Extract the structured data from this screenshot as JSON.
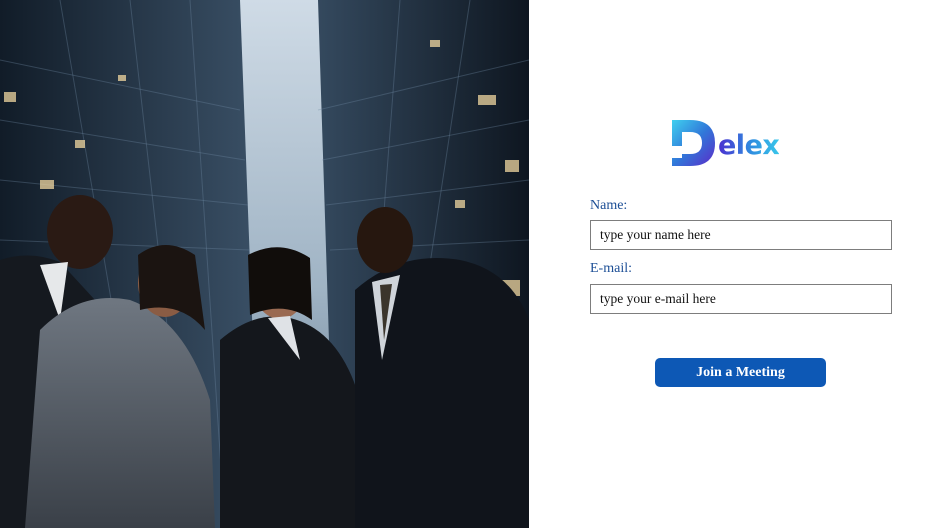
{
  "hero": {
    "image": "business-team-low-angle-skyscrapers-photo"
  },
  "brand": {
    "name": "Delex",
    "mark_letter": "D",
    "text": "elex",
    "colors": {
      "start": "#4b2fd0",
      "mid": "#2f8ee0",
      "end": "#39c6ea"
    }
  },
  "form": {
    "name_label": "Name:",
    "name_placeholder": "type your name here",
    "email_label": "E-mail:",
    "email_placeholder": "type your e-mail here",
    "join_button": "Join a Meeting"
  },
  "colors": {
    "label": "#1d4f96",
    "button": "#0d58b5"
  }
}
